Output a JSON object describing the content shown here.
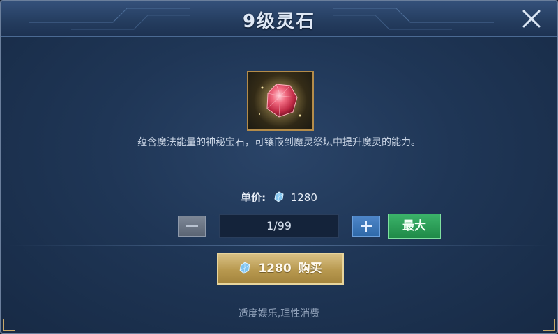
{
  "dialog": {
    "title": "9级灵石",
    "close_icon": "close-icon"
  },
  "item": {
    "icon": "red-gem-icon",
    "description": "蕴含魔法能量的神秘宝石，可镶嵌到魔灵祭坛中提升魔灵的能力。"
  },
  "price": {
    "label": "单价:",
    "currency_icon": "diamond-currency-icon",
    "value": "1280"
  },
  "quantity": {
    "value": "1/99",
    "max_label": "最大"
  },
  "buy_button": {
    "amount": "1280",
    "label": "购买"
  },
  "footer": {
    "note": "适度娱乐,理性消费"
  },
  "colors": {
    "accent_gold": "#b8994f",
    "max_green": "#2a9d55",
    "plus_blue": "#3a78bb",
    "background": "#1f3656"
  }
}
